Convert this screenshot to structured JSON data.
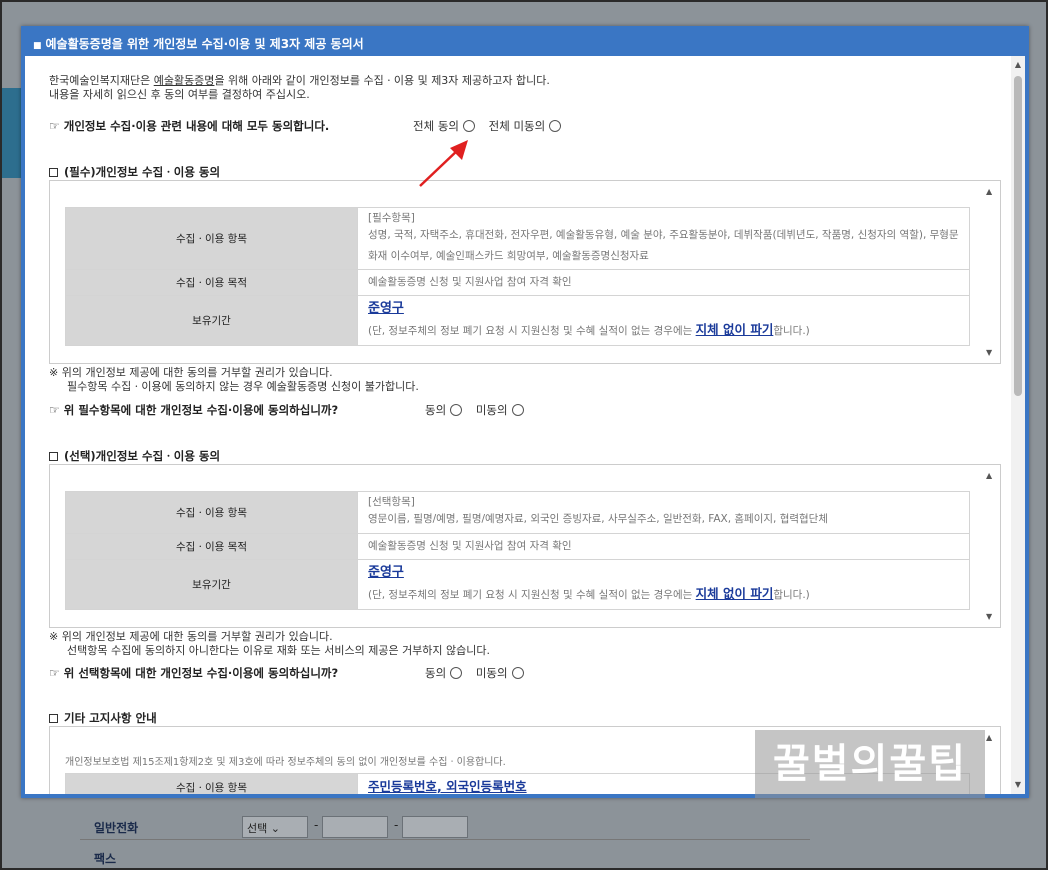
{
  "background_form": {
    "phone_label": "일반전화",
    "fax_label": "팩스",
    "select_value": "선택",
    "dash": "-"
  },
  "modal": {
    "title": "예술활동증명을 위한 개인정보 수집·이용 및 제3자 제공 동의서",
    "intro_line1_pre": "한국예술인복지재단은 ",
    "intro_line1_link": "예술활동증명",
    "intro_line1_post": "을 위해 아래와 같이 개인정보를 수집ㆍ이용 및 제3자 제공하고자 합니다.",
    "intro_line2": "내용을 자세히 읽으신 후 동의 여부를 결정하여 주십시오.",
    "all_agree_text": "개인정보 수집·이용 관련 내용에 대해 모두 동의합니다.",
    "all_agree_yes": "전체 동의",
    "all_agree_no": "전체 미동의",
    "required": {
      "section_title": "(필수)개인정보 수집ㆍ이용 동의",
      "row1_head": "수집ㆍ이용 항목",
      "row1_tag": "[필수항목]",
      "row1_value": "성명, 국적, 자택주소, 휴대전화, 전자우편, 예술활동유형, 예술 분야, 주요활동분야, 데뷔작품(데뷔년도, 작품명, 신청자의 역할), 무형문화재 이수여부, 예술인패스카드 희망여부, 예술활동증명신청자료",
      "row2_head": "수집ㆍ이용 목적",
      "row2_value": "예술활동증명 신청 및 지원사업 참여 자격 확인",
      "row3_head": "보유기간",
      "row3_link": "준영구",
      "row3_note_pre": "(단, 정보주체의 정보 폐기 요청 시 지원신청 및 수혜 실적이 없는 경우에는 ",
      "row3_note_link": "지체 없이 파기",
      "row3_note_post": "합니다.)",
      "note1": "※ 위의 개인정보 제공에 대한 동의를 거부할 권리가 있습니다.",
      "note2": "필수항목 수집ㆍ이용에 동의하지 않는 경우 예술활동증명 신청이 불가합니다.",
      "question": "위 필수항목에 대한 개인정보 수집·이용에 동의하십니까?",
      "yes": "동의",
      "no": "미동의"
    },
    "optional": {
      "section_title": "(선택)개인정보 수집ㆍ이용 동의",
      "row1_head": "수집ㆍ이용 항목",
      "row1_tag": "[선택항목]",
      "row1_value": "영문이름, 필명/예명, 필명/예명자료, 외국인 증빙자료, 사무실주소, 일반전화, FAX, 홈페이지, 협력협단체",
      "row2_head": "수집ㆍ이용 목적",
      "row2_value": "예술활동증명 신청 및 지원사업 참여 자격 확인",
      "row3_head": "보유기간",
      "row3_link": "준영구",
      "row3_note_pre": "(단, 정보주체의 정보 폐기 요청 시 지원신청 및 수혜 실적이 없는 경우에는 ",
      "row3_note_link": "지체 없이 파기",
      "row3_note_post": "합니다.)",
      "note1": "※ 위의 개인정보 제공에 대한 동의를 거부할 권리가 있습니다.",
      "note2": "선택항목 수집에 동의하지 아니한다는 이유로 재화 또는 서비스의 제공은 거부하지 않습니다.",
      "question": "위 선택항목에 대한 개인정보 수집·이용에 동의하십니까?",
      "yes": "동의",
      "no": "미동의"
    },
    "other": {
      "section_title": "기타 고지사항 안내",
      "desc": "개인정보보호법 제15조제1항제2호 및 제3호에 따라 정보주체의 동의 없이 개인정보를 수집ㆍ이용합니다.",
      "row1_head": "수집ㆍ이용 항목",
      "row1_value": "주민등록번호, 외국인등록번호"
    }
  },
  "watermark": "꿀벌의꿀팁",
  "colors": {
    "modal_blue": "#3a76c4",
    "link_blue": "#1a3a9a",
    "table_head": "#d6d6d6",
    "arrow_red": "#e02020"
  }
}
